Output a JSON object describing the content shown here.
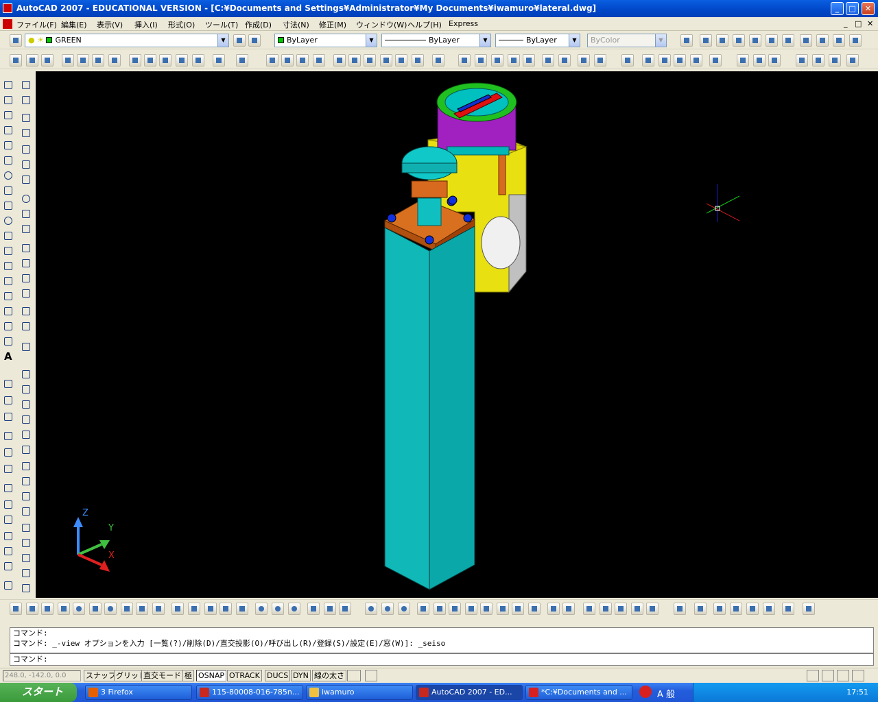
{
  "window": {
    "title": "AutoCAD 2007 - EDUCATIONAL VERSION - [C:¥Documents and Settings¥Administrator¥My Documents¥iwamuro¥lateral.dwg]",
    "minimize": "_",
    "maximize": "□",
    "close": "✕"
  },
  "menubar": {
    "items": [
      "ファイル(F)",
      "編集(E)",
      "表示(V)",
      "挿入(I)",
      "形式(O)",
      "ツール(T)",
      "作成(D)",
      "寸法(N)",
      "修正(M)",
      "ウィンドウ(W)",
      "ヘルプ(H)",
      "Express"
    ],
    "doc_controls": [
      "_",
      "□",
      "✕"
    ]
  },
  "properties": {
    "layer": "GREEN",
    "color": "ByLayer",
    "linetype": "ByLayer",
    "lineweight": "ByLayer",
    "plotstyle": "ByColor"
  },
  "ucs_icon": {
    "z": "Z",
    "y": "Y",
    "x": "X"
  },
  "command": {
    "line1": "コマンド:",
    "line2": "コマンド: _-view オプションを入力 [一覧(?)/削除(D)/直交投影(O)/呼び出し(R)/登録(S)/設定(E)/窓(W)]: _seiso",
    "prompt": "コマンド:"
  },
  "status": {
    "coords": "248.0, -142.0, 0.0",
    "toggles": [
      {
        "label": "スナップ",
        "on": false
      },
      {
        "label": "グリッド",
        "on": false
      },
      {
        "label": "直交モード",
        "on": false
      },
      {
        "label": "極",
        "on": false
      },
      {
        "label": "OSNAP",
        "on": true
      },
      {
        "label": "OTRACK",
        "on": false
      },
      {
        "label": "DUCS",
        "on": false
      },
      {
        "label": "DYN",
        "on": false
      },
      {
        "label": "線の太さ",
        "on": false
      }
    ]
  },
  "taskbar": {
    "start": "スタート",
    "tasks": [
      {
        "label": "3 Firefox",
        "color": "#e66000"
      },
      {
        "label": "115-80008-016-785n...",
        "color": "#c8281e"
      },
      {
        "label": "iwamuro",
        "color": "#f0c040"
      },
      {
        "label": "AutoCAD 2007 - ED...",
        "color": "#c8281e"
      },
      {
        "label": "*C:¥Documents and ...",
        "color": "#d82020"
      }
    ],
    "ime": "A 般",
    "clock": "17:51"
  }
}
